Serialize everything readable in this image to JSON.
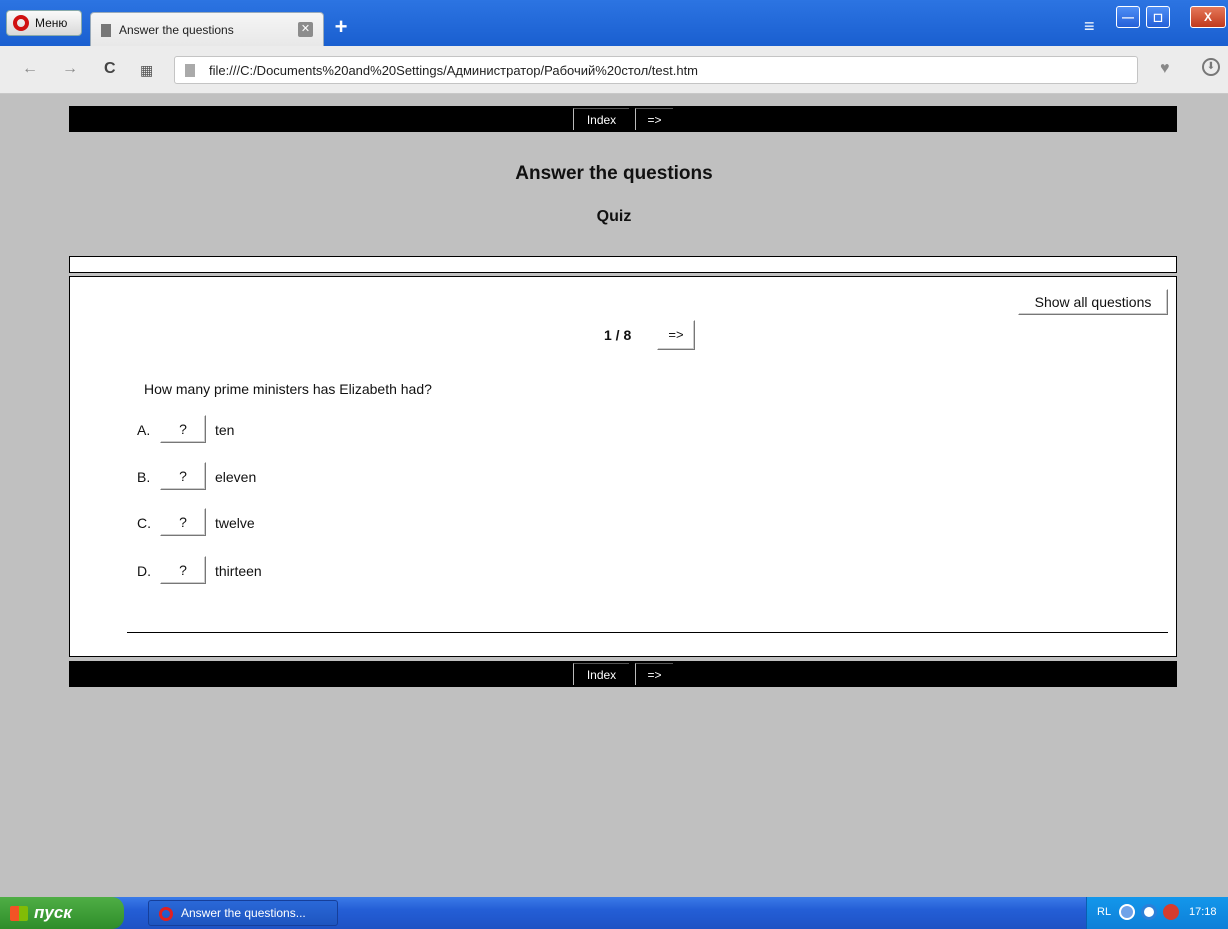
{
  "browser": {
    "menu_label": "Меню",
    "tab_title": "Answer the questions",
    "tab_close": "✕",
    "new_tab": "+",
    "url": "file:///C:/Documents%20and%20Settings/Администратор/Рабочий%20стол/test.htm",
    "nav_icons": {
      "back": "←",
      "forward": "→",
      "reload": "C",
      "speed_dial": "▦",
      "heart": "♥",
      "download": "⬇"
    }
  },
  "window_controls": {
    "minimize": "—",
    "maximize": "◻",
    "close": "X"
  },
  "page": {
    "nav": {
      "index": "Index",
      "next": "=>"
    },
    "title": "Answer the questions",
    "subtitle": "Quiz"
  },
  "quiz": {
    "show_all_label": "Show all questions",
    "counter": "1 / 8",
    "next_label": "=>",
    "question": "How many prime ministers has Elizabeth had?",
    "options": [
      {
        "letter": "A.",
        "button": "?",
        "text": "ten"
      },
      {
        "letter": "B.",
        "button": "?",
        "text": "eleven"
      },
      {
        "letter": "C.",
        "button": "?",
        "text": "twelve"
      },
      {
        "letter": "D.",
        "button": "?",
        "text": "thirteen"
      }
    ]
  },
  "taskbar": {
    "start_label": "пуск",
    "item_label": "Answer the questions...",
    "language": "RL",
    "time": "17:18"
  }
}
